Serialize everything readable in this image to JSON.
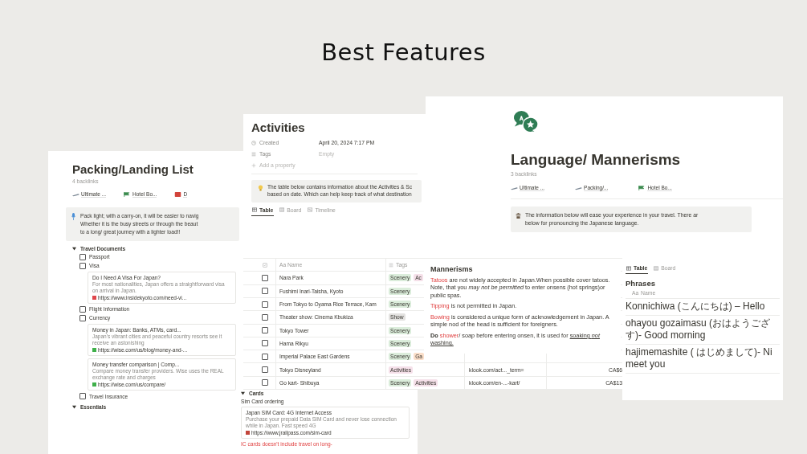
{
  "heading": "Best Features",
  "packing": {
    "title": "Packing/Landing List",
    "backlinks_count": "4 backlinks",
    "backlinks": [
      {
        "label": "Ultimate ..."
      },
      {
        "label": "Hotel Bo..."
      },
      {
        "label": "D"
      }
    ],
    "callout": [
      "Pack light; with a carry-on, it will be easier to navig",
      "Whether it is the busy streets or through the beaut",
      "to a long/ great journey with a lighter load!!"
    ],
    "toggles": [
      {
        "title": "Travel Documents",
        "expanded": true,
        "items": [
          {
            "label": "Passport",
            "checked": false
          },
          {
            "label": "Visa",
            "checked": false,
            "bookmarks": [
              {
                "title": "Do I Need A Visa For Japan?",
                "description": "For most nationalities, Japan offers a straightforward visa on arrival in Japan.",
                "url": "https://www.insidekyoto.com/need-vi...",
                "color": "#e0474c"
              }
            ]
          },
          {
            "label": "Flight Information",
            "checked": false
          },
          {
            "label": "Currency",
            "checked": false,
            "bookmarks": [
              {
                "title": "Money in Japan: Banks, ATMs, card...",
                "description": "Japan's vibrant cities and peaceful country resorts see it receive an astonishing",
                "url": "https://wise.com/us/blog/money-and-...",
                "color": "#3fb04a"
              },
              {
                "title": "Money transfer comparison | Comp...",
                "description": "Compare money transfer providers. Wise uses the REAL exchange rate and charges",
                "url": "https://wise.com/us/compare/",
                "color": "#3fb04a"
              }
            ]
          },
          {
            "label": "Travel Insurance",
            "checked": false
          }
        ]
      },
      {
        "title": "Essentials",
        "expanded": true
      }
    ],
    "cards": {
      "title": "Cards",
      "expanded": true,
      "text": "Sim Card ordering",
      "bookmark": {
        "title": "Japan SIM Card: 4G Internet Access",
        "description": "Purchase your prepaid Data SIM Card and never lose connection while in Japan. Fast speed 4G",
        "url": "https://www.jrailpass.com/sim-card",
        "color": "#c2453a"
      },
      "note": "IC cards doesn't include travel on long-"
    }
  },
  "activities": {
    "title": "Activities",
    "properties": [
      {
        "label": "Created",
        "value": "April 20, 2024 7:17 PM",
        "empty": false
      },
      {
        "label": "Tags",
        "value": "Empty",
        "empty": true
      }
    ],
    "add_property": "Add a property",
    "callout": [
      "The table below contains information about the Activities & Sc",
      "based on date. Which can help keep track of what destination"
    ],
    "tabs": [
      {
        "label": "Table",
        "selected": true
      },
      {
        "label": "Board",
        "selected": false
      },
      {
        "label": "Timeline",
        "selected": false
      }
    ],
    "columns": [
      {
        "prefix": "Aa",
        "label": "Name"
      },
      {
        "label": "Tags"
      }
    ],
    "rows": [
      {
        "name": "Nara Park",
        "checked": false,
        "tags": [
          {
            "label": "Scenery",
            "color": "#dbeddb"
          },
          {
            "label": "Ac",
            "color": "#f5e0e9"
          }
        ]
      },
      {
        "name": "Fushimi Inari-Taisha, Kyoto",
        "checked": false,
        "tags": [
          {
            "label": "Scenery",
            "color": "#dbeddb"
          }
        ]
      },
      {
        "name": "From Tokyo to Oyama Rice Terrace, Kam",
        "checked": false,
        "tags": [
          {
            "label": "Scenery",
            "color": "#dbeddb"
          }
        ]
      },
      {
        "name": "Theater show: Cinema Kbukiza",
        "checked": false,
        "tags": [
          {
            "label": "Show",
            "color": "#e3e2e0"
          }
        ]
      },
      {
        "name": "Tokyo Tower",
        "checked": false,
        "tags": [
          {
            "label": "Scenery",
            "color": "#dbeddb"
          }
        ]
      },
      {
        "name": "Hama Rikyu",
        "checked": false,
        "tags": [
          {
            "label": "Scenery",
            "color": "#dbeddb"
          }
        ]
      },
      {
        "name": "Imperial Palace East Gardens",
        "checked": false,
        "tags": [
          {
            "label": "Scenery",
            "color": "#dbeddb"
          },
          {
            "label": "Ga",
            "color": "#fadec9"
          }
        ]
      },
      {
        "name": "Tokyo Disneyland",
        "checked": false,
        "tags": [
          {
            "label": "Activities",
            "color": "#f5e0e9"
          }
        ],
        "link": "klook.com/act..._term=",
        "price": "CA$6"
      },
      {
        "name": "Go kart- Shibuya",
        "checked": false,
        "tags": [
          {
            "label": "Scenery",
            "color": "#dbeddb"
          },
          {
            "label": "Activities",
            "color": "#f5e0e9"
          }
        ],
        "link": "klook.com/en-...-kart/",
        "price": "CA$13"
      }
    ]
  },
  "language": {
    "title": "Language/ Mannerisms",
    "backlinks_count": "3 backlinks",
    "backlinks": [
      {
        "label": "Ultimate ..."
      },
      {
        "label": "Packing/..."
      },
      {
        "label": "Hotel Bo..."
      }
    ],
    "callout": [
      "The information below will ease your experience in your travel. There ar",
      "below for pronouncing the Japanese language."
    ],
    "mannerisms": {
      "title": "Mannerisms",
      "paragraphs": [
        [
          {
            "text": "Tatoos",
            "kind": "red"
          },
          {
            "text": " are not widely accepted in Japan.When possible cover tatoos. Note, that you ",
            "kind": "plain"
          },
          {
            "text": "may not be permitted",
            "kind": "italic"
          },
          {
            "text": " to enter onsens (hot springs)or public spas.",
            "kind": "plain"
          }
        ],
        [
          {
            "text": "Tipping",
            "kind": "red"
          },
          {
            "text": " is not permitted in Japan.",
            "kind": "plain"
          }
        ],
        [
          {
            "text": "Bowing",
            "kind": "red"
          },
          {
            "text": " is considered a unique form of acknowledgement in Japan. A simple nod of the head is sufficient for foreigners.",
            "kind": "plain"
          }
        ],
        [
          {
            "text": "Do ",
            "kind": "bold"
          },
          {
            "text": "shower",
            "kind": "red"
          },
          {
            "text": "/ soap before entering onsen, it is used for ",
            "kind": "plain"
          },
          {
            "text": "soaking ",
            "kind": "underline"
          },
          {
            "text": "not",
            "kind": "underline-italic"
          },
          {
            "text": " washing.",
            "kind": "underline"
          }
        ]
      ]
    },
    "tabs": [
      {
        "label": "Table",
        "selected": true
      },
      {
        "label": "Board",
        "selected": false
      }
    ],
    "phrases": {
      "title": "Phrases",
      "column": {
        "prefix": "Aa",
        "label": "Name"
      },
      "rows": [
        [
          "Konnichiwa (こんにちは) – Hello"
        ],
        [
          "ohayou gozaimasu (おはようござ",
          "す)- Good morning"
        ],
        [
          "hajimemashite ( はじめまして)- Ni",
          "meet you"
        ]
      ]
    }
  }
}
